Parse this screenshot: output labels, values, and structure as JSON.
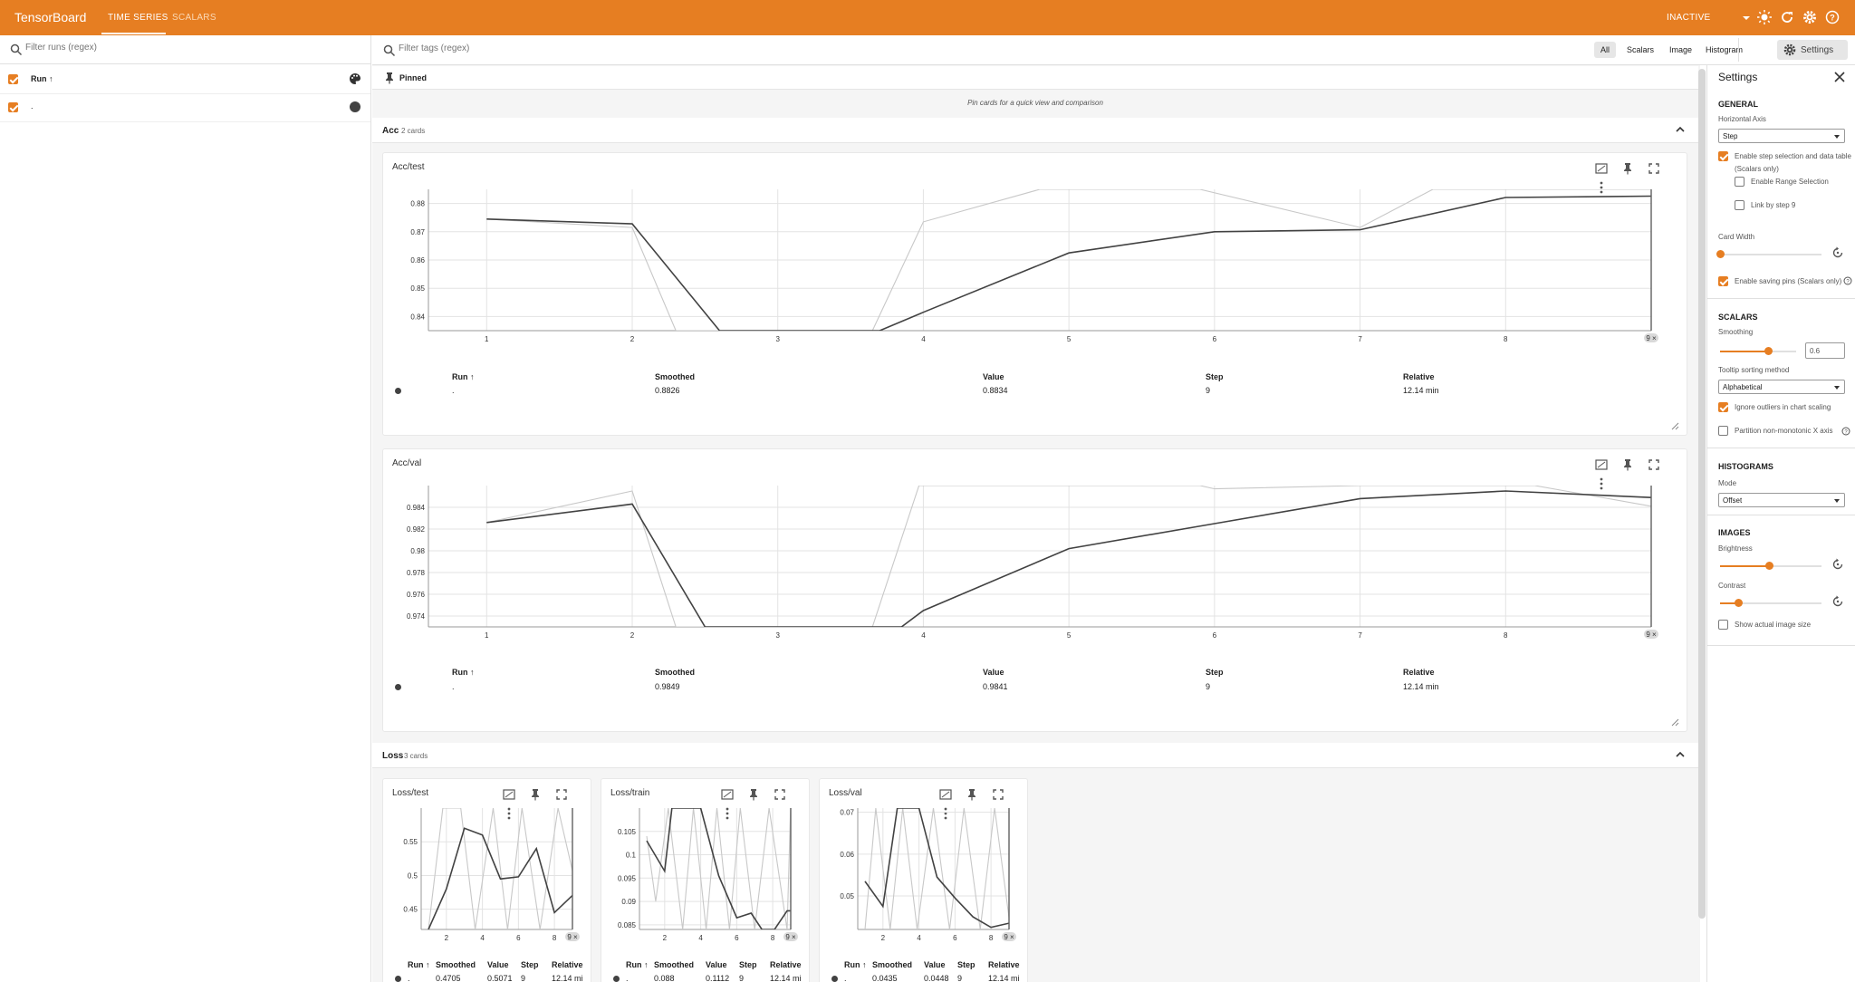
{
  "header": {
    "brand": "TensorBoard",
    "tabs": [
      {
        "label": "TIME SERIES"
      },
      {
        "label": "SCALARS"
      }
    ],
    "status": "INACTIVE",
    "icons": [
      "brightness-icon",
      "refresh-icon",
      "settings-gear-icon",
      "help-icon"
    ]
  },
  "runs_panel": {
    "filter_placeholder": "Filter runs (regex)",
    "header_label": "Run ↑",
    "run_name": ".",
    "run_color": "#424242"
  },
  "toolbar": {
    "filter_tags_placeholder": "Filter tags (regex)",
    "types": [
      "All",
      "Scalars",
      "Image",
      "Histogram"
    ],
    "settings_label": "Settings"
  },
  "pinned": {
    "label": "Pinned",
    "hint": "Pin cards for a quick view and comparison"
  },
  "groups": {
    "acc": {
      "name": "Acc",
      "count": "2 cards"
    },
    "loss": {
      "name": "Loss",
      "count": "3 cards"
    }
  },
  "table_headers": {
    "run": "Run ↑",
    "smoothed": "Smoothed",
    "value": "Value",
    "step": "Step",
    "relative": "Relative"
  },
  "cards": {
    "acc_test": {
      "title": "Acc/test",
      "run": ".",
      "smoothed": "0.8826",
      "value": "0.8834",
      "step": "9",
      "relative": "12.14 min",
      "step_marker": "9"
    },
    "acc_val": {
      "title": "Acc/val",
      "run": ".",
      "smoothed": "0.9849",
      "value": "0.9841",
      "step": "9",
      "relative": "12.14 min",
      "step_marker": "9"
    },
    "loss_test": {
      "title": "Loss/test",
      "run": ".",
      "smoothed": "0.4705",
      "value": "0.5071",
      "step": "9",
      "relative": "12.14 mi",
      "step_marker": "9"
    },
    "loss_train": {
      "title": "Loss/train",
      "run": ".",
      "smoothed": "0.088",
      "value": "0.1112",
      "step": "9",
      "relative": "12.14 mi",
      "step_marker": "9"
    },
    "loss_val": {
      "title": "Loss/val",
      "run": ".",
      "smoothed": "0.0435",
      "value": "0.0448",
      "step": "9",
      "relative": "12.14 mi",
      "step_marker": "9"
    }
  },
  "chart_data": [
    {
      "type": "line",
      "title": "Acc/test",
      "x_ticks": [
        "1",
        "2",
        "3",
        "4",
        "5",
        "6",
        "7",
        "8",
        "9"
      ],
      "y_ticks": [
        "0.88",
        "0.87",
        "0.86",
        "0.85",
        "0.84"
      ],
      "ylim": [
        0.835,
        0.885
      ],
      "series": [
        {
          "x": [
            1,
            2,
            2.6,
            3.7,
            4,
            5,
            6,
            7,
            8,
            9
          ],
          "values": [
            0.8745,
            0.8728,
            0.835,
            0.835,
            0.8415,
            0.8625,
            0.87,
            0.8707,
            0.8821,
            0.8826
          ]
        },
        {
          "x": [
            1,
            2,
            2.3,
            3.65,
            4,
            4.8,
            5.9,
            7,
            7.5,
            9
          ],
          "values": [
            0.8745,
            0.8715,
            0.835,
            0.835,
            0.8735,
            0.885,
            0.885,
            0.8715,
            0.885,
            0.885
          ]
        }
      ]
    },
    {
      "type": "line",
      "title": "Acc/val",
      "x_ticks": [
        "1",
        "2",
        "3",
        "4",
        "5",
        "6",
        "7",
        "8",
        "9"
      ],
      "y_ticks": [
        "0.984",
        "0.982",
        "0.98",
        "0.978",
        "0.976",
        "0.974"
      ],
      "ylim": [
        0.973,
        0.986
      ],
      "series": [
        {
          "x": [
            1,
            2,
            2.5,
            3.85,
            4,
            5,
            6,
            7,
            8,
            9
          ],
          "values": [
            0.9826,
            0.9843,
            0.973,
            0.973,
            0.9745,
            0.9802,
            0.9825,
            0.9848,
            0.9855,
            0.9849
          ]
        },
        {
          "x": [
            1,
            2,
            2.3,
            3.65,
            3.97,
            5.9,
            6,
            7,
            8.2,
            9
          ],
          "values": [
            0.9826,
            0.9855,
            0.973,
            0.973,
            0.986,
            0.986,
            0.9857,
            0.986,
            0.986,
            0.9841
          ]
        }
      ]
    },
    {
      "type": "line",
      "title": "Loss/test",
      "x_ticks": [
        "2",
        "4",
        "6",
        "8",
        "9"
      ],
      "y_ticks": [
        "0.55",
        "0.5",
        "0.45"
      ],
      "ylim": [
        0.42,
        0.6
      ],
      "series": [
        {
          "x": [
            1,
            2,
            3,
            4,
            5,
            6,
            7,
            8,
            9
          ],
          "values": [
            0.42,
            0.48,
            0.57,
            0.56,
            0.495,
            0.498,
            0.54,
            0.445,
            0.4705
          ]
        },
        {
          "x": [
            1,
            1.8,
            2.8,
            3.6,
            4.6,
            5.4,
            6.2,
            7.2,
            8.2,
            9
          ],
          "values": [
            0.42,
            0.6,
            0.6,
            0.42,
            0.6,
            0.42,
            0.6,
            0.42,
            0.6,
            0.5071
          ]
        }
      ]
    },
    {
      "type": "line",
      "title": "Loss/train",
      "x_ticks": [
        "2",
        "4",
        "6",
        "8",
        "9"
      ],
      "y_ticks": [
        "0.105",
        "0.1",
        "0.095",
        "0.09",
        "0.085"
      ],
      "ylim": [
        0.084,
        0.11
      ],
      "series": [
        {
          "x": [
            1,
            2,
            2.4,
            3,
            4,
            5,
            6,
            6.8,
            7.4,
            8.1,
            8.8,
            9
          ],
          "values": [
            0.103,
            0.0965,
            0.11,
            0.11,
            0.11,
            0.0955,
            0.0865,
            0.0875,
            0.084,
            0.084,
            0.088,
            0.088
          ]
        },
        {
          "x": [
            1,
            1.5,
            2.2,
            3,
            3.6,
            4.3,
            4.9,
            5.6,
            6.2,
            7.0,
            7.8,
            8.8,
            9
          ],
          "values": [
            0.104,
            0.09,
            0.11,
            0.084,
            0.11,
            0.084,
            0.11,
            0.084,
            0.11,
            0.084,
            0.11,
            0.084,
            0.1112
          ]
        }
      ]
    },
    {
      "type": "line",
      "title": "Loss/val",
      "x_ticks": [
        "2",
        "4",
        "6",
        "8",
        "9"
      ],
      "y_ticks": [
        "0.07",
        "0.06",
        "0.05"
      ],
      "ylim": [
        0.042,
        0.071
      ],
      "series": [
        {
          "x": [
            1,
            2,
            2.8,
            4,
            5,
            6,
            7,
            8,
            9
          ],
          "values": [
            0.0535,
            0.0475,
            0.071,
            0.071,
            0.0545,
            0.0495,
            0.045,
            0.0425,
            0.0435
          ]
        },
        {
          "x": [
            1,
            1.6,
            2.4,
            3.1,
            3.9,
            4.8,
            5.7,
            6.5,
            7.4,
            8.2,
            9
          ],
          "values": [
            0.042,
            0.071,
            0.042,
            0.071,
            0.042,
            0.071,
            0.042,
            0.071,
            0.042,
            0.071,
            0.0448
          ]
        }
      ]
    }
  ],
  "settings": {
    "title": "Settings",
    "general": {
      "heading": "GENERAL",
      "horizontal_axis_label": "Horizontal Axis",
      "horizontal_axis_value": "Step",
      "step_selection_label": "Enable step selection and data table",
      "step_selection_sub": "(Scalars only)",
      "range_selection_label": "Enable Range Selection",
      "link_by_step_label": "Link by step 9",
      "card_width_label": "Card Width",
      "saving_pins_label": "Enable saving pins (Scalars only)"
    },
    "scalars": {
      "heading": "SCALARS",
      "smoothing_label": "Smoothing",
      "smoothing_value": "0.6",
      "tooltip_sort_label": "Tooltip sorting method",
      "tooltip_sort_value": "Alphabetical",
      "ignore_outliers_label": "Ignore outliers in chart scaling",
      "partition_label": "Partition non-monotonic X axis"
    },
    "histograms": {
      "heading": "HISTOGRAMS",
      "mode_label": "Mode",
      "mode_value": "Offset"
    },
    "images": {
      "heading": "IMAGES",
      "brightness_label": "Brightness",
      "contrast_label": "Contrast",
      "actual_size_label": "Show actual image size"
    }
  }
}
